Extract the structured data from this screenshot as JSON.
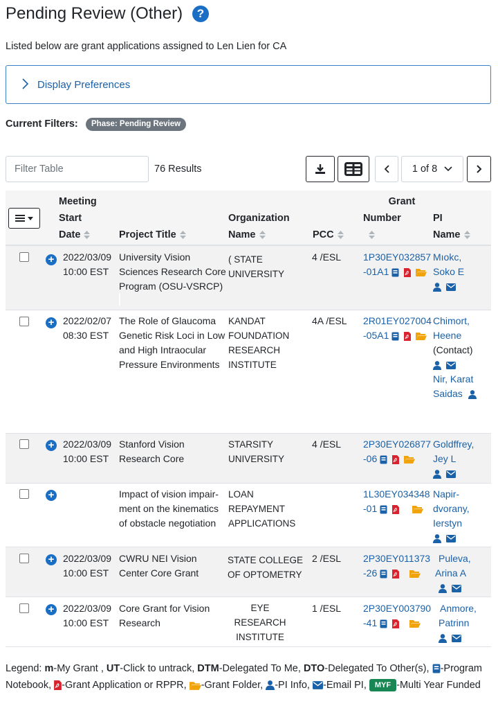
{
  "page": {
    "title": "Pending Review (Other)",
    "subtitle": "Listed below are grant applications assigned to Len Lien for CA"
  },
  "preferences": {
    "label": "Display Preferences"
  },
  "filters": {
    "label": "Current Filters:",
    "badge": "Phase: Pending Review"
  },
  "toolbar": {
    "filter_placeholder": "Filter Table",
    "results": "76 Results",
    "page_indicator": "1 of 8"
  },
  "columns": {
    "meeting": [
      "Meeting",
      "Start",
      "Date"
    ],
    "project": "Project Title",
    "org": [
      "Organization",
      "Name"
    ],
    "pcc": "PCC",
    "grant": [
      "Grant",
      "Number"
    ],
    "pi": [
      "PI",
      "Name"
    ]
  },
  "rows": [
    {
      "date": "2022/03/09",
      "time": "10:00 EST",
      "title": [
        "University Vision",
        "Sciences Research Core",
        "Program (OSU-VSRCP)"
      ],
      "org": [
        "( STATE",
        "UNIVERSITY"
      ],
      "pcc": "4 /ESL",
      "grant": [
        "1P30EY032857",
        "-01A1"
      ],
      "pi": [
        "Mıokc,",
        "Soko E"
      ]
    },
    {
      "date": "2022/02/07",
      "time": "08:30 EST",
      "title": [
        "The Role of Glaucoma",
        "Genetic Risk Loci in Low",
        "and High Intraocular",
        "Pressure Environments"
      ],
      "org": [
        "KANDAT",
        "FOUNDATION",
        "RESEARCH",
        "INSTITUTE"
      ],
      "pcc": "4A /ESL",
      "grant": [
        "2R01EY027004",
        "-05A1"
      ],
      "pi": [
        "Chimort,",
        "Heene"
      ],
      "pi_contact": "(Contact)",
      "pi2": [
        "Nir, Karat",
        "Saidas"
      ]
    },
    {
      "date": "2022/03/09",
      "time": "10:00 EST",
      "title": [
        "Stanford Vision",
        "Research Core"
      ],
      "org": [
        "STARSITY",
        "UNIVERSITY"
      ],
      "pcc": "4 /ESL",
      "grant": [
        "2P30EY026877",
        "-06"
      ],
      "pi": [
        "Goldffrey,",
        "Jey L"
      ]
    },
    {
      "date": "",
      "time": "",
      "title": [
        "Impact of vision impair-",
        "ment on the kinematics",
        "of obstacle negotiation"
      ],
      "org": [
        "LOAN",
        "REPAYMENT",
        "APPLICATIONS"
      ],
      "pcc": "",
      "grant": [
        "1L30EY034348",
        "-01"
      ],
      "pi": [
        "Napir-",
        "dvorany,",
        "Ierstyn"
      ]
    },
    {
      "date": "2022/03/09",
      "time": "10:00 EST",
      "title": [
        "CWRU NEI Vision",
        "Center Core Grant"
      ],
      "org": [
        "STATE COLLEGE",
        "OF OPTOMETRY"
      ],
      "pcc": "2 /ESL",
      "grant": [
        "2P30EY011373",
        "-26"
      ],
      "pi": [
        "Puleva,",
        "Arina A"
      ]
    },
    {
      "date": "2022/03/09",
      "time": "10:00 EST",
      "title": [
        "Core Grant for Vision",
        "Research"
      ],
      "org": [
        "EYE RESEARCH",
        "INSTITUTE"
      ],
      "pcc": "1 /ESL",
      "grant": [
        "2P30EY003790",
        "-41"
      ],
      "pi": [
        "Anmore,",
        "Patrinn"
      ]
    }
  ],
  "legend": {
    "prefix": "Legend:",
    "m_key": "m",
    "m_text": "-My Grant ,",
    "ut_key": "UT",
    "ut_text": "-Click to untrack,",
    "dtm_key": "DTM",
    "dtm_text": "-Delegated To Me,",
    "dto_key": "DTO",
    "dto_text": "-Delegated To Other(s),",
    "notebook_text": "-Program Notebook,",
    "pdf_text": "-Grant Application or RPPR,",
    "folder_text": "-Grant Folder,",
    "pi_text": "-PI Info,",
    "email_text": "-Email PI,",
    "myf_badge": "MYF",
    "myf_text": "-Multi Year Funded"
  },
  "colors": {
    "link": "#1a61a8",
    "accent": "#1a6fc4",
    "pdf": "#d9232e",
    "folder": "#f0a30a",
    "myf": "#198754",
    "badge": "#6c757d"
  }
}
